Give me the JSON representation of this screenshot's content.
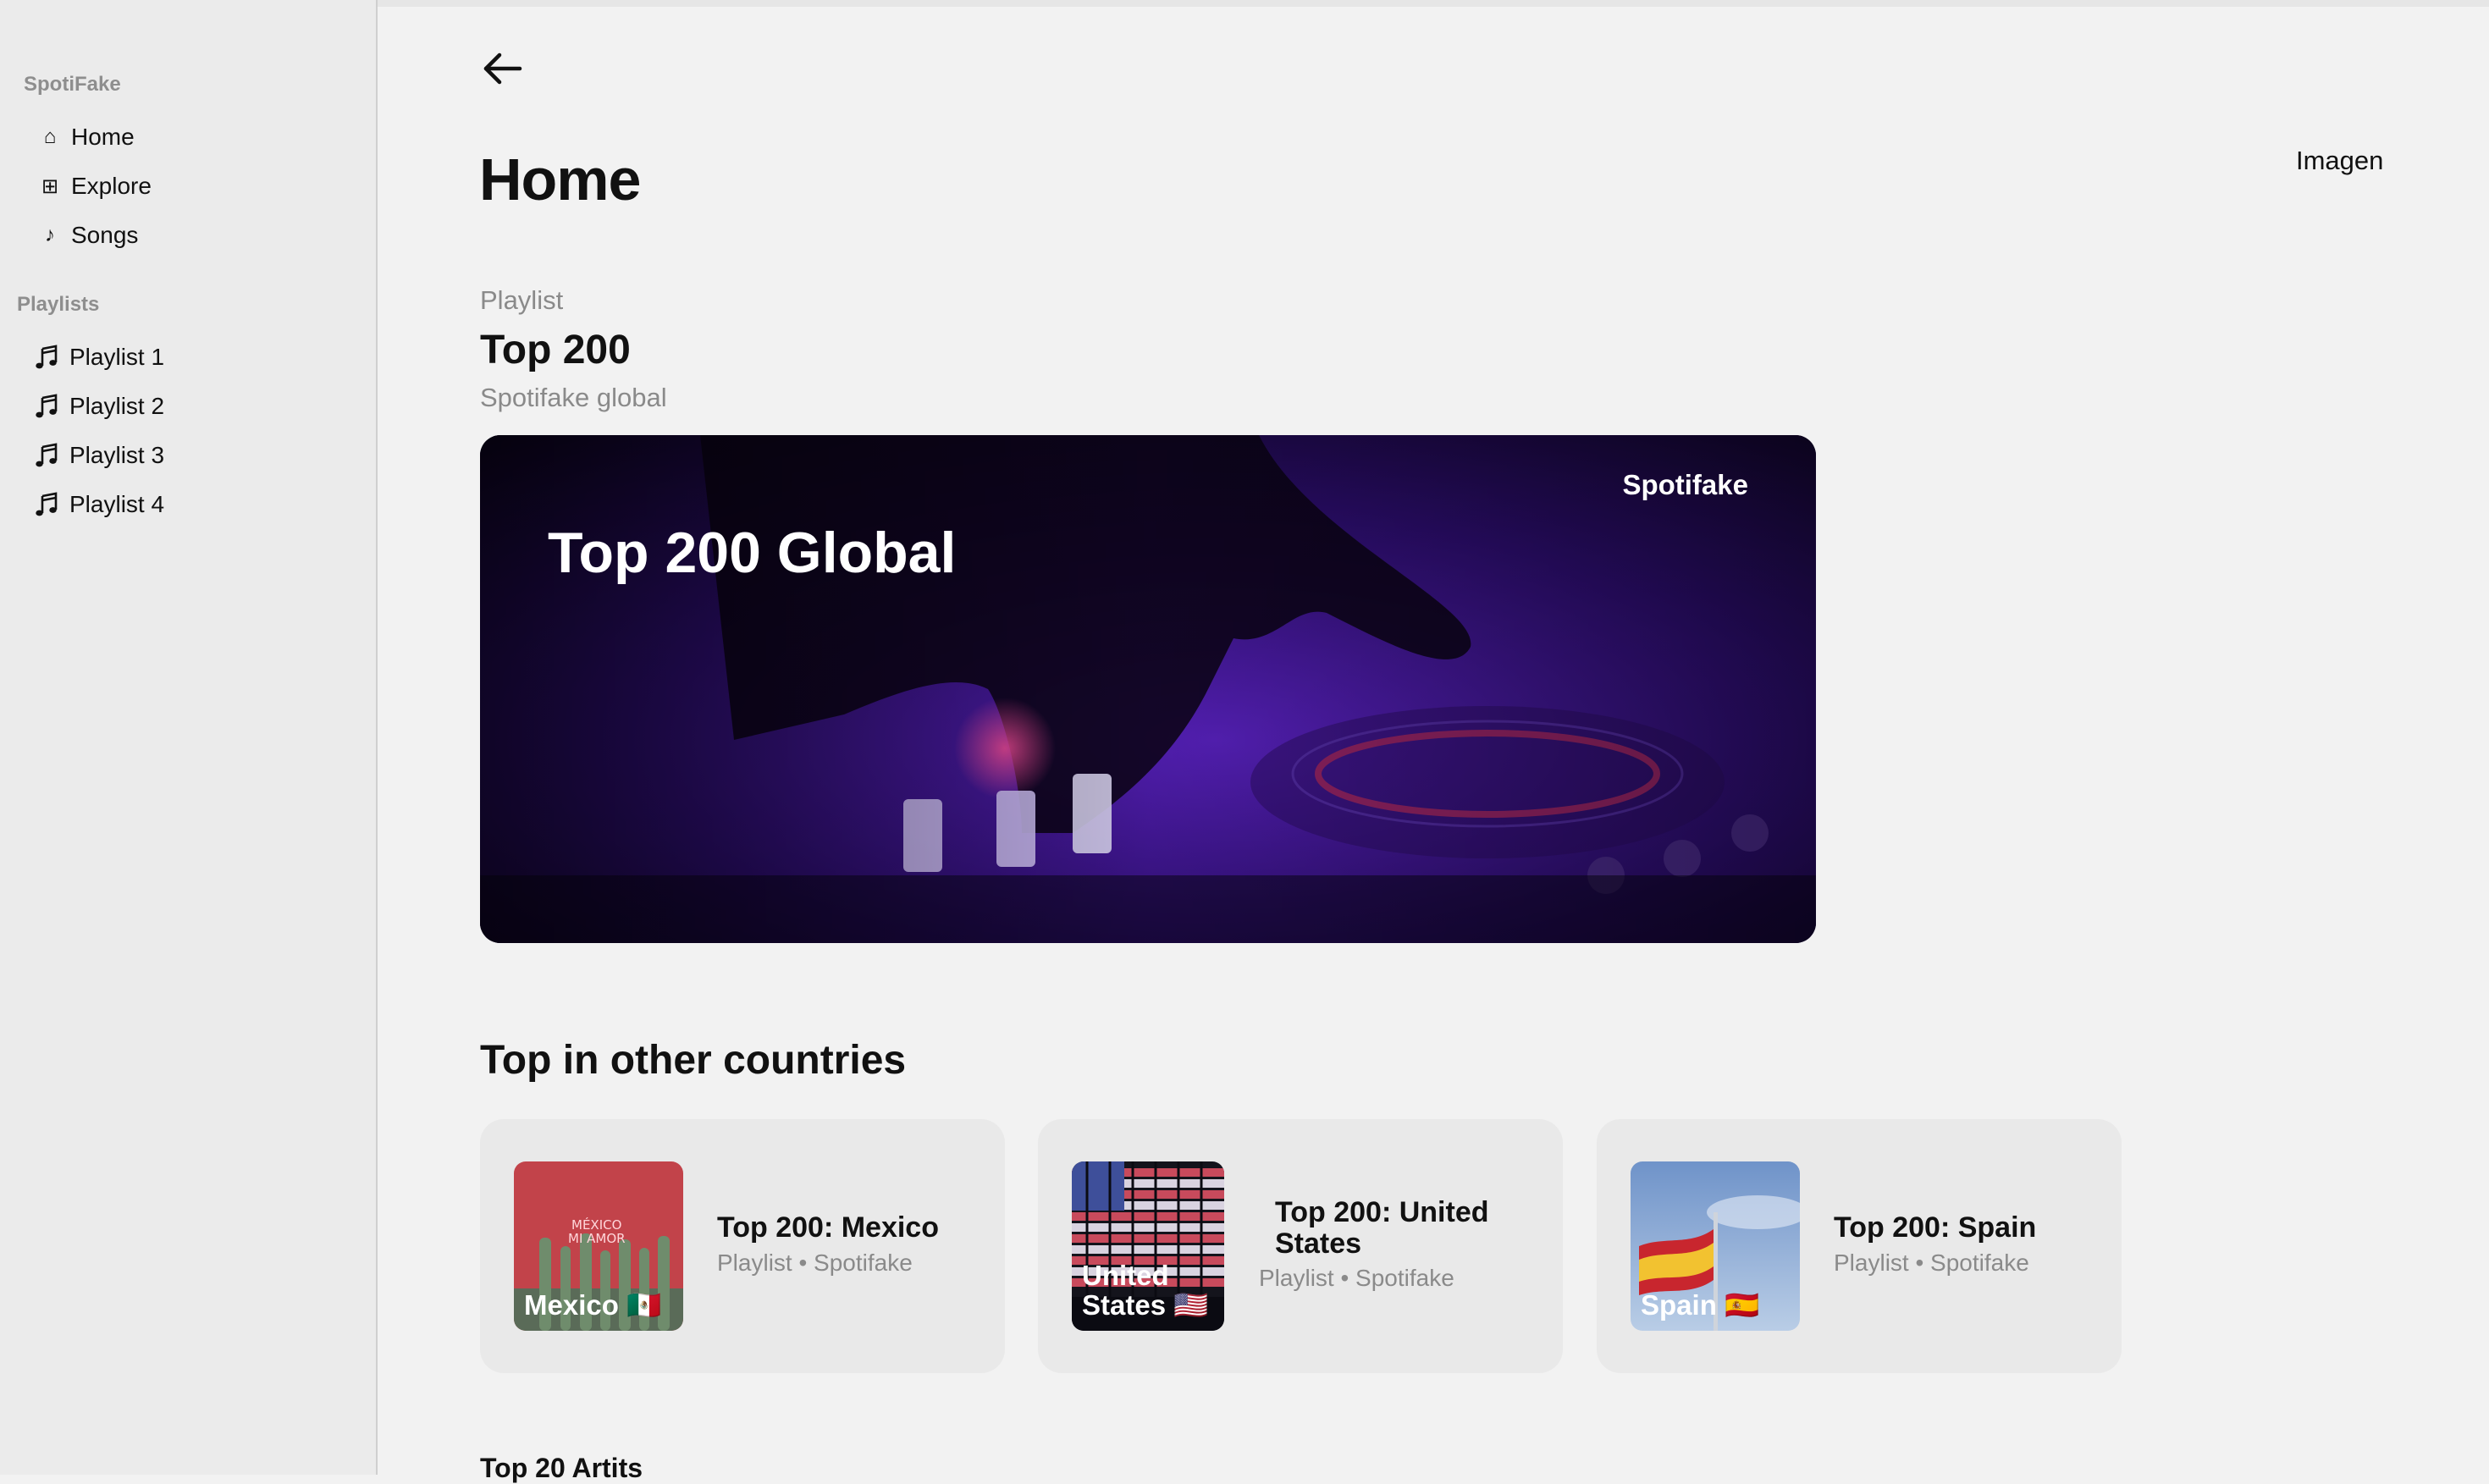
{
  "app": {
    "brand": "SpotiFake"
  },
  "sidebar": {
    "nav": [
      {
        "icon": "home-icon",
        "glyph": "⌂",
        "label": "Home"
      },
      {
        "icon": "explore-icon",
        "glyph": "⊞",
        "label": "Explore"
      },
      {
        "icon": "music-note-icon",
        "glyph": "♪",
        "label": "Songs"
      }
    ],
    "playlists_label": "Playlists",
    "playlists": [
      {
        "label": "Playlist 1"
      },
      {
        "label": "Playlist 2"
      },
      {
        "label": "Playlist 3"
      },
      {
        "label": "Playlist 4"
      }
    ]
  },
  "header": {
    "back_icon": "arrow-left-icon",
    "title": "Home",
    "right_link": "Imagen"
  },
  "featured": {
    "kind": "Playlist",
    "title": "Top 200",
    "subtitle": "Spotifake global",
    "banner_title": "Top 200 Global",
    "banner_brand": "Spotifake"
  },
  "countries": {
    "heading": "Top in other countries",
    "cards": [
      {
        "art_label": "Mexico 🇲🇽",
        "title": "Top 200: Mexico",
        "subtitle": "Playlist • Spotifake"
      },
      {
        "art_label": "United States 🇺🇸",
        "title": "Top 200: United States",
        "subtitle": "Playlist • Spotifake"
      },
      {
        "art_label": "Spain 🇪🇸",
        "title": "Top 200: Spain",
        "subtitle": "Playlist • Spotifake"
      }
    ]
  },
  "next_section": {
    "heading": "Top 20 Artits"
  },
  "colors": {
    "background": "#f2f2f2",
    "sidebar": "#ebebeb",
    "card": "#e9e9e9",
    "muted_text": "#8a8a8a",
    "banner_accent": "#6a2bd8"
  }
}
